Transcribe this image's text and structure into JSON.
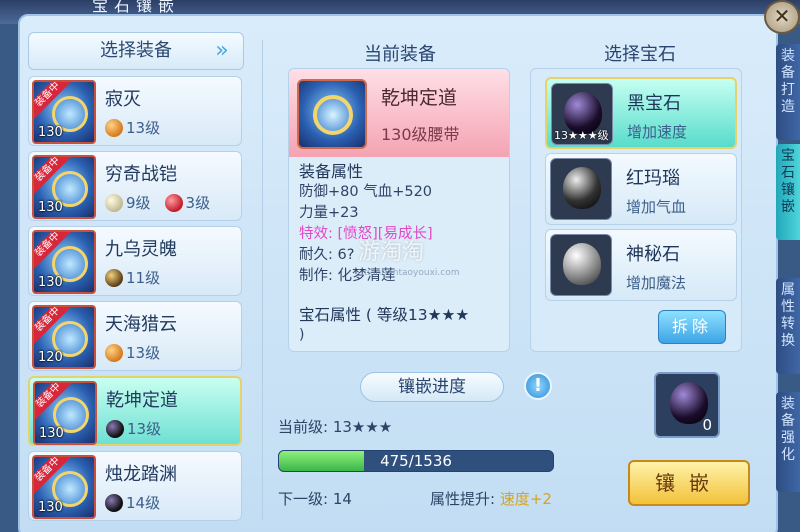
{
  "window": {
    "top_title": "宝石镶嵌",
    "close_label": "✕"
  },
  "side_tabs": [
    "装备打造",
    "宝石镶嵌",
    "属性转换",
    "装备强化"
  ],
  "left": {
    "header": "选择装备",
    "items": [
      {
        "name": "寂灭",
        "level": "130",
        "badge": "装备中",
        "gems": [
          {
            "type": "orange",
            "text": "13级"
          }
        ]
      },
      {
        "name": "穷奇战铠",
        "level": "130",
        "badge": "装备中",
        "gems": [
          {
            "type": "white",
            "text": "9级"
          },
          {
            "type": "red",
            "text": "3级"
          }
        ]
      },
      {
        "name": "九乌灵魄",
        "level": "130",
        "badge": "装备中",
        "gems": [
          {
            "type": "gold",
            "text": "11级"
          }
        ]
      },
      {
        "name": "天海猎云",
        "level": "120",
        "badge": "装备中",
        "gems": [
          {
            "type": "orange",
            "text": "13级"
          }
        ]
      },
      {
        "name": "乾坤定道",
        "level": "130",
        "badge": "装备中",
        "gems": [
          {
            "type": "black",
            "text": "13级"
          }
        ]
      },
      {
        "name": "烛龙踏渊",
        "level": "130",
        "badge": "装备中",
        "gems": [
          {
            "type": "black",
            "text": "14级"
          }
        ]
      }
    ]
  },
  "current_equip": {
    "title": "当前装备",
    "name": "乾坤定道",
    "subtitle": "130级腰带",
    "attr_header": "装备属性",
    "attr_line1": "防御+80 气血+520",
    "attr_line2": "力量+23",
    "special": "特效: [愤怒][易成长]",
    "durability": "耐久: 6?",
    "maker": "制作: 化梦清莲",
    "gem_attr": "宝石属性 ( 等级13★★★",
    "gem_attr_end": ")"
  },
  "gem_select": {
    "title": "选择宝石",
    "items": [
      {
        "name": "黑宝石",
        "desc": "增加速度",
        "stone": "black",
        "level": "13★★★级"
      },
      {
        "name": "红玛瑙",
        "desc": "增加气血",
        "stone": "red",
        "level": ""
      },
      {
        "name": "神秘石",
        "desc": "增加魔法",
        "stone": "myst",
        "level": ""
      }
    ],
    "remove_label": "拆除"
  },
  "progress": {
    "title": "镶嵌进度",
    "info_label": "!",
    "current_level": "当前级: 13★★★",
    "bar_text": "475/1536",
    "fraction": 0.309,
    "next_level": "下一级: 14",
    "attr_up_label": "属性提升:",
    "attr_up_value": "速度+2"
  },
  "owned_gem": {
    "count": "0"
  },
  "inlay_label": "镶嵌",
  "watermark": {
    "main": "游淘淘",
    "sub": "tiantiantaoyouxi.com"
  },
  "colors": {
    "accent": "#3ca4e6",
    "progress": "#3cb54a",
    "selected": "#58dccc"
  }
}
